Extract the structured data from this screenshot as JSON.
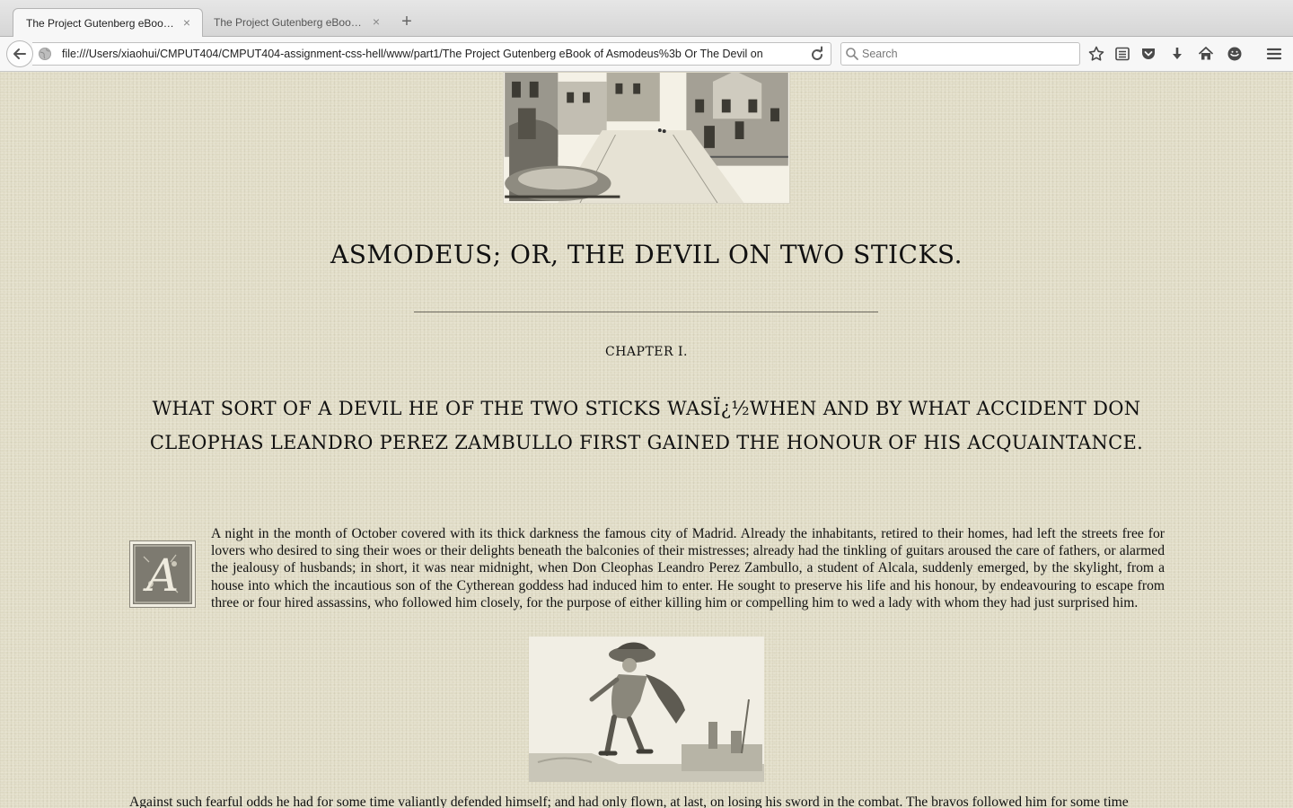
{
  "tabs": [
    {
      "title": "The Project Gutenberg eBook o...",
      "active": true
    },
    {
      "title": "The Project Gutenberg eBook o...",
      "active": false
    }
  ],
  "tab_close_glyph": "×",
  "new_tab_glyph": "+",
  "nav": {
    "url": "file:///Users/xiaohui/CMPUT404/CMPUT404-assignment-css-hell/www/part1/The Project Gutenberg eBook of Asmodeus%3b Or The Devil on",
    "search_placeholder": "Search"
  },
  "toolbar_icons": [
    "bookmark-star-icon",
    "reading-list-icon",
    "pocket-icon",
    "download-icon",
    "home-icon",
    "chat-icon",
    "menu-icon"
  ],
  "page": {
    "book_title": "ASMODEUS; OR, THE DEVIL ON TWO STICKS.",
    "chapter_label": "CHAPTER I.",
    "chapter_heading": "What sort of a devil he of the two sticks wasï¿½when and by what accident Don Cleophas Leandro Perez Zambullo first gained the honour of his acquaintance.",
    "dropcap_letter": "A",
    "paragraph_1": "A night in the month of October covered with its thick darkness the famous city of Madrid. Already the inhabitants, retired to their homes, had left the streets free for lovers who desired to sing their woes or their delights beneath the balconies of their mistresses; already had the tinkling of guitars aroused the care of fathers, or alarmed the jealousy of husbands; in short, it was near midnight, when Don Cleophas Leandro Perez Zambullo, a student of Alcala, suddenly emerged, by the skylight, from a house into which the incautious son of the Cytherean goddess had induced him to enter. He sought to preserve his life and his honour, by endeavouring to escape from three or four hired assassins, who followed him closely, for the purpose of either killing him or compelling him to wed a lady with whom they had just surprised him.",
    "paragraph_2": "Against such fearful odds he had for some time valiantly defended himself; and had only flown, at last, on losing his sword in the combat. The bravos followed him for some time"
  },
  "colors": {
    "page_background": "#e3dfca",
    "text": "#111111",
    "chrome": "#f7f7f7"
  }
}
